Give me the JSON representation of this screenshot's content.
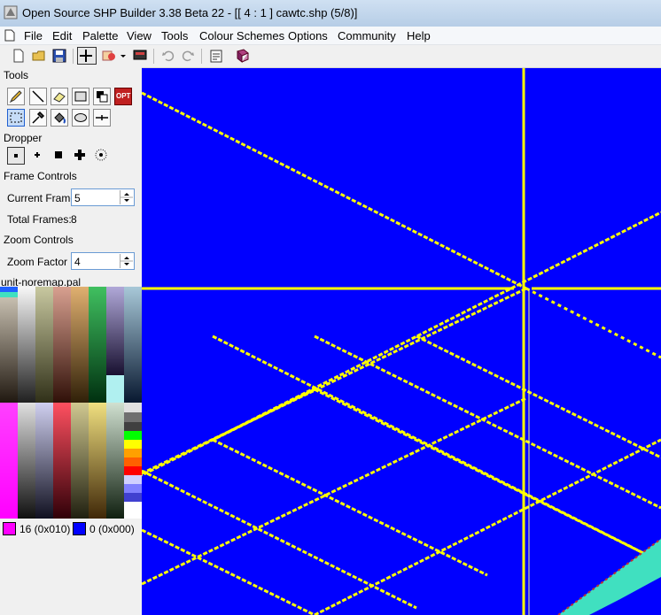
{
  "window": {
    "title": "Open Source SHP Builder 3.38 Beta 22 - [[ 4 : 1 ] cawtc.shp (5/8)]"
  },
  "menu": [
    "File",
    "Edit",
    "Palette",
    "View",
    "Tools",
    "Colour Schemes",
    "Options",
    "Community",
    "Help"
  ],
  "icons": {
    "toolbar": [
      "new-file-icon",
      "open-folder-icon",
      "save-icon",
      "crosshair-icon",
      "preview-icon",
      "dropdown-arrow-icon",
      "monitor-icon",
      "undo-icon",
      "redo-icon",
      "properties-icon",
      "help-book-icon"
    ],
    "tools": [
      "pencil-icon",
      "line-icon",
      "eraser-icon",
      "rectangle-icon",
      "darken-lighten-icon",
      "opt-icon",
      "select-icon",
      "dropper-icon",
      "flood-fill-icon",
      "ellipse-icon",
      "crosshair-line-icon"
    ],
    "dropper_sizes": [
      "single-pixel-icon",
      "small-plus-icon",
      "square-icon",
      "round-brush-icon",
      "spray-icon"
    ]
  },
  "tools_panel": {
    "tools_label": "Tools",
    "opt_label": "OPT",
    "dropper_label": "Dropper"
  },
  "frame_controls": {
    "label": "Frame Controls",
    "current_frame_label": "Current Frame",
    "current_frame": "5",
    "total_frames_label": "Total Frames:",
    "total_frames": "8"
  },
  "zoom_controls": {
    "label": "Zoom Controls",
    "zoom_factor_label": "Zoom Factor",
    "zoom_factor": "4"
  },
  "palette": {
    "name": "unit-noremap.pal",
    "left_color_label": "16 (0x010)",
    "right_color_label": "0 (0x000)",
    "left_color": "#ff00ff",
    "right_color": "#0000ff"
  },
  "colors": {
    "canvas_bg": "#0000ff",
    "grid_line": "#ffff00",
    "shape_fill": "#40e0c0",
    "shape_edge": "#c03030"
  }
}
